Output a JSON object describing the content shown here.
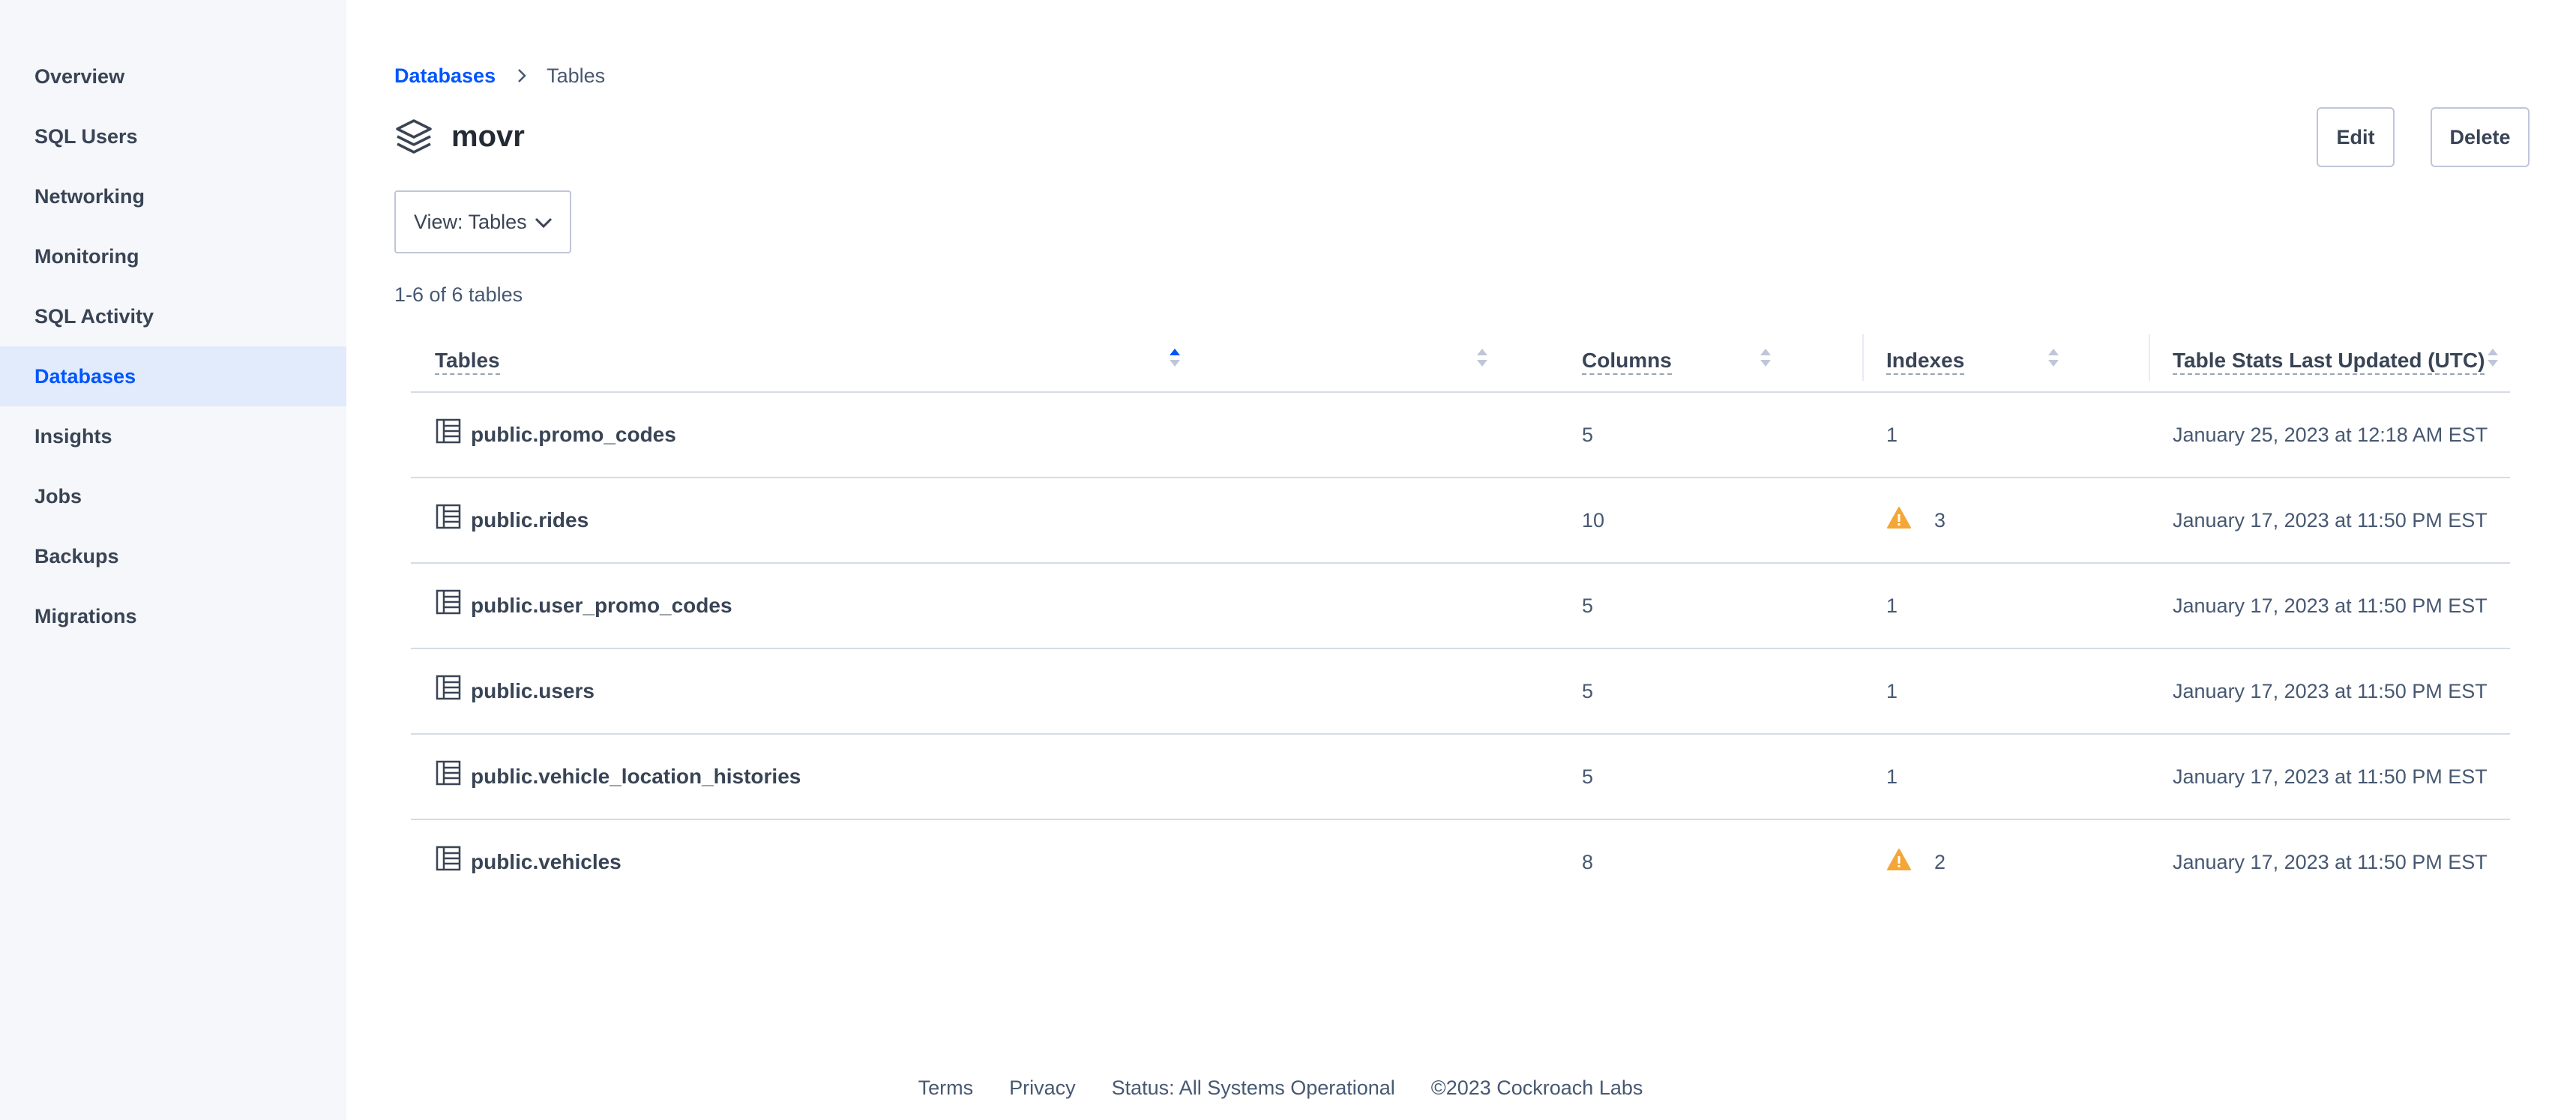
{
  "sidebar": {
    "items": [
      {
        "label": "Overview"
      },
      {
        "label": "SQL Users"
      },
      {
        "label": "Networking"
      },
      {
        "label": "Monitoring"
      },
      {
        "label": "SQL Activity"
      },
      {
        "label": "Databases",
        "active": true
      },
      {
        "label": "Insights"
      },
      {
        "label": "Jobs"
      },
      {
        "label": "Backups"
      },
      {
        "label": "Migrations"
      }
    ]
  },
  "breadcrumb": {
    "parent": "Databases",
    "current": "Tables",
    "separator_icon": "chevron-right-icon"
  },
  "header": {
    "icon": "database-layers-icon",
    "title": "movr",
    "edit_label": "Edit",
    "delete_label": "Delete"
  },
  "view_select": {
    "value": "View: Tables",
    "icon": "chevron-down-icon"
  },
  "table_count": "1-6 of 6 tables",
  "table": {
    "columns": [
      "Tables",
      "Columns",
      "Indexes",
      "Table Stats Last Updated (UTC)"
    ],
    "rows": [
      {
        "name": "public.promo_codes",
        "columns": "5",
        "indexes": "1",
        "warning": false,
        "updated": "January 25, 2023 at 12:18 AM EST"
      },
      {
        "name": "public.rides",
        "columns": "10",
        "indexes": "3",
        "warning": true,
        "updated": "January 17, 2023 at 11:50 PM EST"
      },
      {
        "name": "public.user_promo_codes",
        "columns": "5",
        "indexes": "1",
        "warning": false,
        "updated": "January 17, 2023 at 11:50 PM EST"
      },
      {
        "name": "public.users",
        "columns": "5",
        "indexes": "1",
        "warning": false,
        "updated": "January 17, 2023 at 11:50 PM EST"
      },
      {
        "name": "public.vehicle_location_histories",
        "columns": "5",
        "indexes": "1",
        "warning": false,
        "updated": "January 17, 2023 at 11:50 PM EST"
      },
      {
        "name": "public.vehicles",
        "columns": "8",
        "indexes": "2",
        "warning": true,
        "updated": "January 17, 2023 at 11:50 PM EST"
      }
    ]
  },
  "footer": {
    "terms": "Terms",
    "privacy": "Privacy",
    "status": "Status: All Systems Operational",
    "copyright": "©2023 Cockroach Labs"
  },
  "colors": {
    "accent": "#0055ff",
    "active_nav_bg": "#e1ebfc",
    "sidebar_bg": "#f5f7fa",
    "warning": "#f4a637"
  }
}
